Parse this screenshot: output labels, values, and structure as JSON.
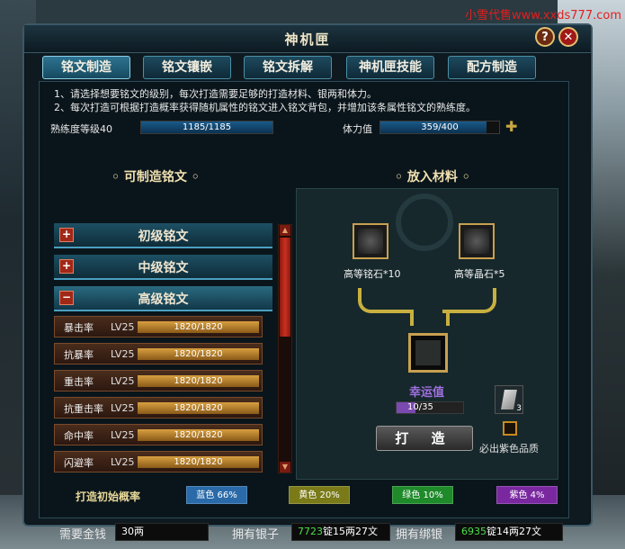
{
  "watermark": "小雪代售www.xxds777.com",
  "window": {
    "title": "神机匣",
    "help_label": "?",
    "close_label": "✕"
  },
  "tabs": [
    {
      "label": "铭文制造",
      "active": true
    },
    {
      "label": "铭文镶嵌",
      "active": false
    },
    {
      "label": "铭文拆解",
      "active": false
    },
    {
      "label": "神机匣技能",
      "active": false
    },
    {
      "label": "配方制造",
      "active": false
    }
  ],
  "notes": [
    "1、请选择想要铭文的级别，每次打造需要足够的打造材料、银两和体力。",
    "2、每次打造可根据打造概率获得随机属性的铭文进入铭文背包，并增加该条属性铭文的熟练度。"
  ],
  "proficiency": {
    "label": "熟练度等级40",
    "value": "1185/1185",
    "fraction": 1.0
  },
  "stamina": {
    "label": "体力值",
    "value": "359/400",
    "fraction": 0.8975
  },
  "left_panel": {
    "heading": "可制造铭文"
  },
  "categories": [
    {
      "toggle": "+",
      "label": "初级铭文"
    },
    {
      "toggle": "+",
      "label": "中级铭文"
    },
    {
      "toggle": "−",
      "label": "高级铭文"
    }
  ],
  "items": [
    {
      "name": "暴击率",
      "level": "LV25",
      "value": "1820/1820"
    },
    {
      "name": "抗暴率",
      "level": "LV25",
      "value": "1820/1820"
    },
    {
      "name": "重击率",
      "level": "LV25",
      "value": "1820/1820"
    },
    {
      "name": "抗重击率",
      "level": "LV25",
      "value": "1820/1820"
    },
    {
      "name": "命中率",
      "level": "LV25",
      "value": "1820/1820"
    },
    {
      "name": "闪避率",
      "level": "LV25",
      "value": "1820/1820"
    }
  ],
  "right_panel": {
    "heading": "放入材料"
  },
  "materials": [
    {
      "label": "高等铭石*10"
    },
    {
      "label": "高等晶石*5"
    }
  ],
  "luck": {
    "label": "幸运值",
    "value": "10/35",
    "fraction": 0.2857
  },
  "craft_button": "打 造",
  "crystal_count": "3",
  "purple_option": "必出紫色品质",
  "probability": {
    "label": "打造初始概率",
    "tiers": [
      {
        "label": "蓝色 66%",
        "color": "#2a6aa8"
      },
      {
        "label": "黄色 20%",
        "color": "#7a7a18"
      },
      {
        "label": "绿色 10%",
        "color": "#1e8a2a"
      },
      {
        "label": "紫色 4%",
        "color": "#7a28a0"
      }
    ]
  },
  "costs": {
    "money_label": "需要金钱",
    "money_value": "30两",
    "silver_label": "拥有银子",
    "silver_green": "7723",
    "silver_rest": "锭15两27文",
    "bound_label": "拥有绑银",
    "bound_green": "6935",
    "bound_rest": "锭14两27文"
  }
}
